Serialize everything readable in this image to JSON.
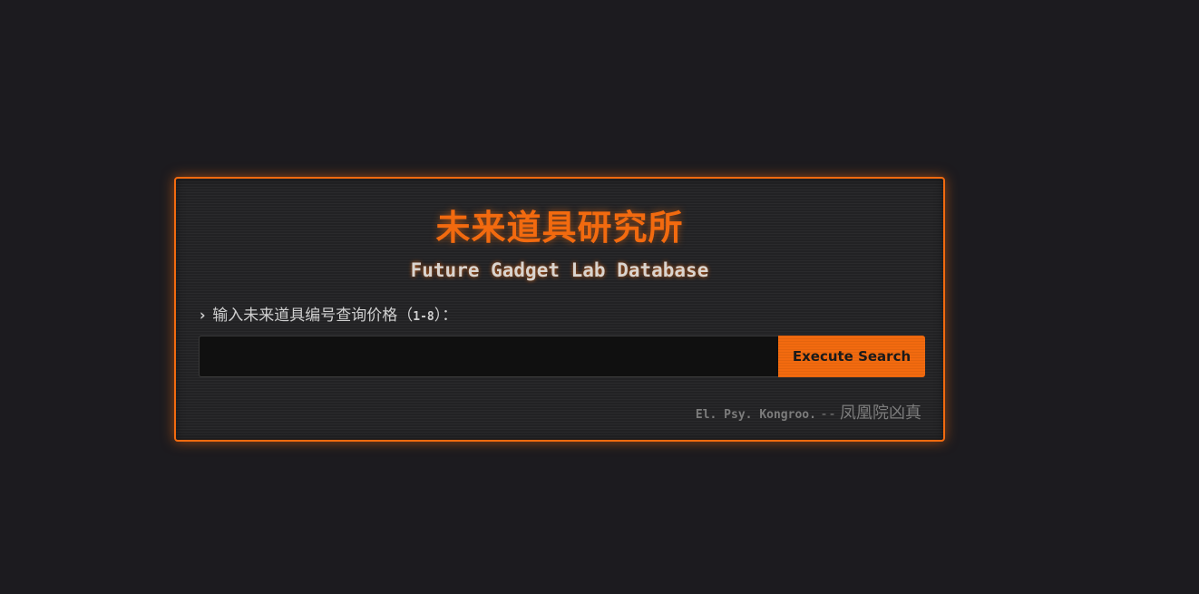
{
  "panel": {
    "title_cn": "未来道具研究所",
    "title_en": "Future Gadget Lab Database",
    "prompt": {
      "caret": "›",
      "label": "输入未来道具编号查询价格（",
      "range": "1-8",
      "suffix": "）："
    },
    "search": {
      "value": "",
      "placeholder": "",
      "button_label": "Execute Search"
    },
    "footer": {
      "motto": "El. Psy. Kongroo.",
      "separator": "--",
      "author": "凤凰院凶真"
    }
  },
  "colors": {
    "accent": "#f26a0f",
    "background": "#1c1b1f",
    "panel": "#222224"
  },
  "icons": {
    "prompt_caret": "chevron-right-icon"
  }
}
